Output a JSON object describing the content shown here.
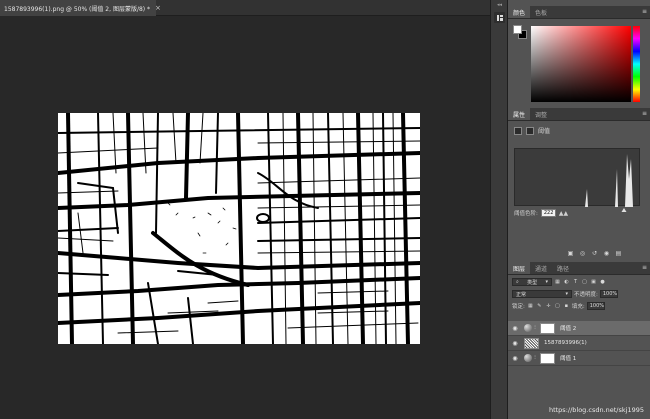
{
  "document_tab": {
    "title": "1587893996(1).png @ 50% (阈值 2, 图层蒙版/8) *",
    "close": "×"
  },
  "panels": {
    "color": {
      "tabs": [
        "颜色",
        "色板"
      ],
      "foreground": "#ffffff",
      "background": "#000000"
    },
    "properties": {
      "tabs": [
        "属性",
        "调整"
      ],
      "mode_label": "阈值",
      "level_label": "阈值色阶:",
      "level_value": "222"
    },
    "layers": {
      "tabs": [
        "图层",
        "通道",
        "路径"
      ],
      "filter_kind": "类型",
      "blend_mode": "正常",
      "opacity_label": "不透明度:",
      "opacity_value": "100%",
      "lock_label": "锁定:",
      "fill_label": "填充:",
      "fill_value": "100%",
      "items": [
        {
          "name": "阈值 2",
          "type": "adjustment",
          "selected": true
        },
        {
          "name": "1587893996(1)",
          "type": "image",
          "selected": false
        },
        {
          "name": "阈值 1",
          "type": "adjustment",
          "selected": false
        }
      ]
    }
  },
  "watermark": "https://blog.csdn.net/skj1995"
}
